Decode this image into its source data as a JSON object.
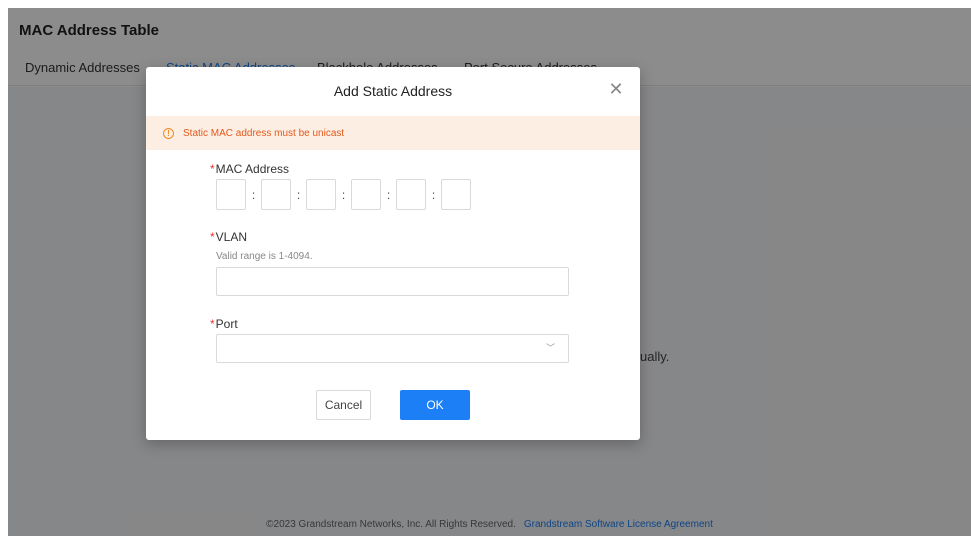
{
  "page": {
    "title": "MAC Address Table",
    "tabs": [
      {
        "label": "Dynamic Addresses"
      },
      {
        "label": "Static MAC Addresses"
      },
      {
        "label": "Blackhole Addresses"
      },
      {
        "label": "Port Secure Addresses"
      }
    ],
    "background_text": "ually.",
    "footer": {
      "copyright": "©2023 Grandstream Networks, Inc. All Rights Reserved.",
      "license_link": "Grandstream Software License Agreement"
    }
  },
  "modal": {
    "title": "Add Static Address",
    "close_icon": "close-icon",
    "alert": {
      "icon": "warning-circle-icon",
      "text": "Static MAC address must be unicast",
      "color": "#e25a1c"
    },
    "mac": {
      "label": "MAC Address",
      "required_mark": "*",
      "separator": ":",
      "octets": [
        "",
        "",
        "",
        "",
        "",
        ""
      ]
    },
    "vlan": {
      "label": "VLAN",
      "required_mark": "*",
      "hint": "Valid range is 1-4094.",
      "value": ""
    },
    "port": {
      "label": "Port",
      "required_mark": "*",
      "value": "",
      "chevron_icon": "chevron-down-icon"
    },
    "buttons": {
      "cancel": "Cancel",
      "ok": "OK"
    }
  },
  "colors": {
    "accent": "#1c7ff5",
    "required": "#ee3333",
    "alert_bg": "#fdeee3"
  }
}
